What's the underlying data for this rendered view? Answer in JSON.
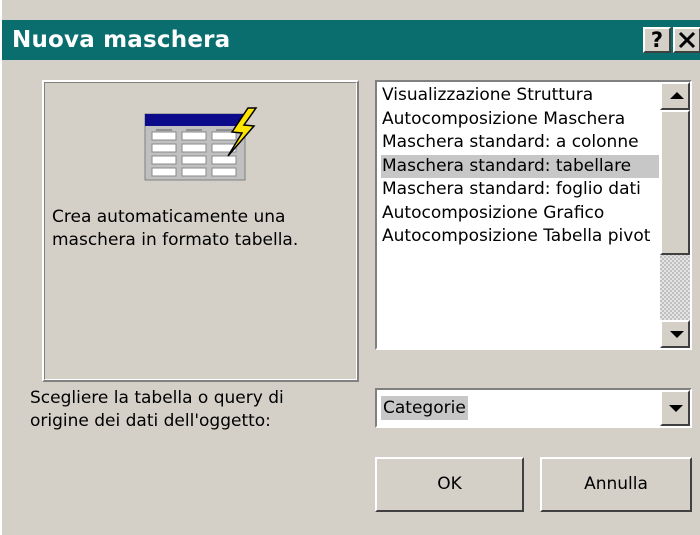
{
  "dialog": {
    "title": "Nuova maschera",
    "help_button": "?",
    "close_button": "✕"
  },
  "preview": {
    "description": "Crea automaticamente una\nmaschera in formato tabella.",
    "icon": "tabular-form-wizard-icon"
  },
  "list": {
    "items": [
      {
        "label": "Visualizzazione Struttura"
      },
      {
        "label": "Autocomposizione Maschera"
      },
      {
        "label": "Maschera standard: a colonne"
      },
      {
        "label": "Maschera standard: tabellare"
      },
      {
        "label": "Maschera standard: foglio dati"
      },
      {
        "label": "Autocomposizione Grafico"
      },
      {
        "label": "Autocomposizione Tabella pivot"
      }
    ],
    "selected_index": 3
  },
  "source": {
    "label": "Scegliere la tabella o query di\norigine dei dati dell'oggetto:",
    "selected": "Categorie"
  },
  "buttons": {
    "ok": "OK",
    "cancel": "Annulla"
  },
  "colors": {
    "titlebar": "#0a6e6e",
    "face": "#d4d0c8",
    "selection": "#c7c7c7"
  }
}
